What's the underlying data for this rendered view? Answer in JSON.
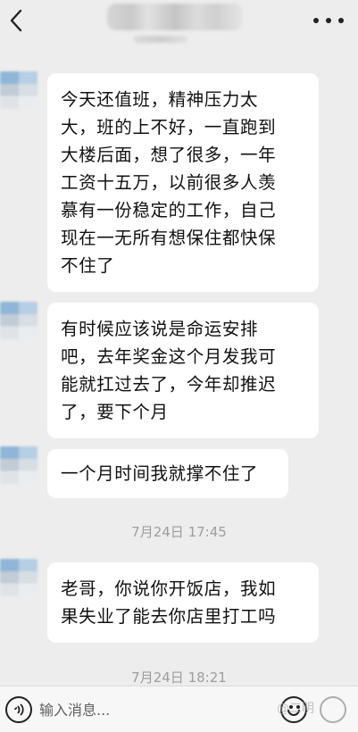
{
  "header": {
    "back_icon": "chevron-left-icon",
    "more_icon": "more-dots-icon"
  },
  "messages": [
    {
      "lines": [
        "今天还值班，精神压力太",
        "大，班的上不好，一直跑到",
        "大楼后面，想了很多，一年",
        "工资十五万，以前很多人羡",
        "慕有一份稳定的工作，自己",
        "现在一无所有想保住都快保",
        "不住了"
      ]
    },
    {
      "lines": [
        "有时候应该说是命运安排",
        "吧，去年奖金这个月发我可",
        "能就扛过去了，今年却推迟",
        "了，要下个月"
      ]
    },
    {
      "lines": [
        "一个月时间我就撑不住了"
      ]
    },
    {
      "lines": [
        "老哥，你说你开饭店，我如",
        "果失业了能去你店里打工吗"
      ]
    }
  ],
  "timestamps": [
    "7月24日 17:45",
    "7月24日 18:21"
  ],
  "input": {
    "placeholder": "输入消息..."
  },
  "watermark": "@二明"
}
